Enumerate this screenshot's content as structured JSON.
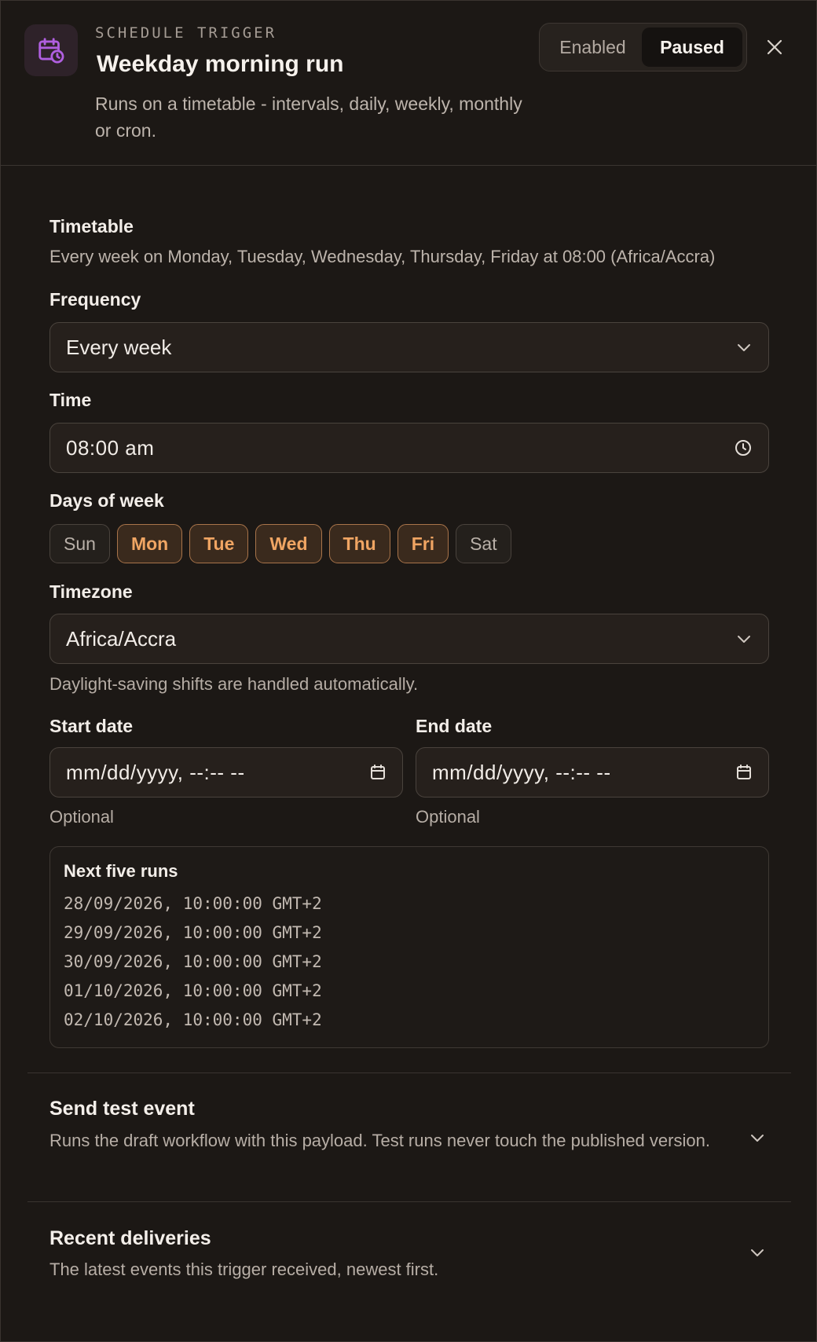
{
  "header": {
    "eyebrow": "SCHEDULE TRIGGER",
    "title": "Weekday morning run",
    "subtitle": "Runs on a timetable - intervals, daily, weekly, monthly or cron.",
    "icon": "calendar-clock-icon",
    "toggle": {
      "enabled_label": "Enabled",
      "paused_label": "Paused",
      "selected": "Paused"
    }
  },
  "timetable": {
    "label": "Timetable",
    "summary": "Every week on Monday, Tuesday, Wednesday, Thursday, Friday at 08:00 (Africa/Accra)"
  },
  "frequency": {
    "label": "Frequency",
    "value": "Every week"
  },
  "time": {
    "label": "Time",
    "value": "08:00 am"
  },
  "days_of_week": {
    "label": "Days of week",
    "days": [
      {
        "label": "Sun",
        "selected": false
      },
      {
        "label": "Mon",
        "selected": true
      },
      {
        "label": "Tue",
        "selected": true
      },
      {
        "label": "Wed",
        "selected": true
      },
      {
        "label": "Thu",
        "selected": true
      },
      {
        "label": "Fri",
        "selected": true
      },
      {
        "label": "Sat",
        "selected": false
      }
    ]
  },
  "timezone": {
    "label": "Timezone",
    "value": "Africa/Accra",
    "helper": "Daylight-saving shifts are handled automatically."
  },
  "start_date": {
    "label": "Start date",
    "placeholder": "mm/dd/yyyy, --:-- --",
    "helper": "Optional"
  },
  "end_date": {
    "label": "End date",
    "placeholder": "mm/dd/yyyy, --:-- --",
    "helper": "Optional"
  },
  "next_runs": {
    "title": "Next five runs",
    "items": [
      "28/09/2026, 10:00:00 GMT+2",
      "29/09/2026, 10:00:00 GMT+2",
      "30/09/2026, 10:00:00 GMT+2",
      "01/10/2026, 10:00:00 GMT+2",
      "02/10/2026, 10:00:00 GMT+2"
    ]
  },
  "send_test_event": {
    "title": "Send test event",
    "description": "Runs the draft workflow with this payload. Test runs never touch the published version."
  },
  "recent_deliveries": {
    "title": "Recent deliveries",
    "description": "The latest events this trigger received, newest first."
  },
  "colors": {
    "background": "#1c1815",
    "accent_orange": "#f0a563",
    "icon_purple": "#b05fe0"
  }
}
